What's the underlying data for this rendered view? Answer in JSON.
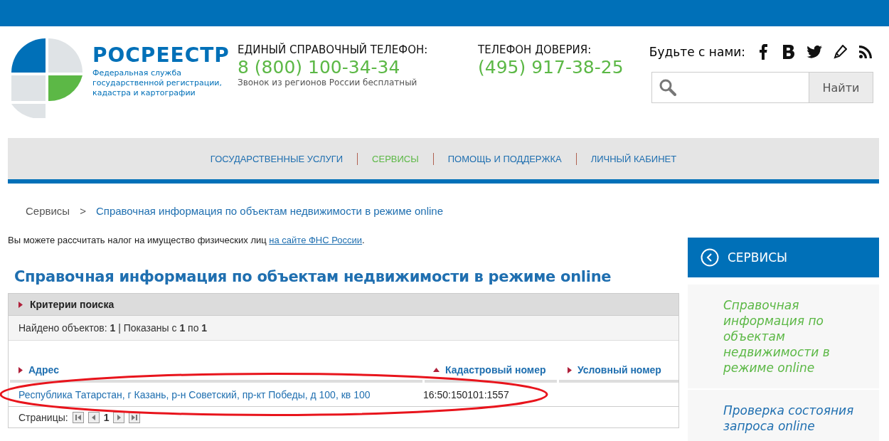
{
  "logo": {
    "name": "РОСРЕЕСТР",
    "tagline": "Федеральная служба государственной регистрации, кадастра и картографии"
  },
  "hotline": {
    "label": "ЕДИНЫЙ СПРАВОЧНЫЙ ТЕЛЕФОН:",
    "number": "8 (800) 100-34-34",
    "note": "Звонок из регионов России бесплатный"
  },
  "trustline": {
    "label": "ТЕЛЕФОН ДОВЕРИЯ:",
    "number": "(495) 917-38-25"
  },
  "social": {
    "label": "Будьте с нами:",
    "links": [
      {
        "kind": "facebook"
      },
      {
        "kind": "vk"
      },
      {
        "kind": "twitter"
      },
      {
        "kind": "blog"
      },
      {
        "kind": "rss"
      }
    ]
  },
  "search": {
    "button": "Найти"
  },
  "nav": [
    {
      "label": "ГОСУДАРСТВЕННЫЕ УСЛУГИ",
      "selected": false
    },
    {
      "label": "СЕРВИСЫ",
      "selected": true
    },
    {
      "label": "ПОМОЩЬ И ПОДДЕРЖКА",
      "selected": false
    },
    {
      "label": "ЛИЧНЫЙ КАБИНЕТ",
      "selected": false
    }
  ],
  "breadcrumb": [
    {
      "label": "Сервисы"
    },
    {
      "label": "Справочная информация по объектам недвижимости в режиме online"
    }
  ],
  "breadcrumb_separator": ">",
  "notice": {
    "text": "Вы можете рассчитать налог на имущество физических лиц ",
    "link": "на сайте ФНС России",
    "end": "."
  },
  "title": "Справочная информация по объектам недвижимости в режиме online",
  "criteria": {
    "label": "Критерии поиска",
    "expanded": false
  },
  "summary": "Найдено объектов: **1** | Показаны с **1** по **1**",
  "table": {
    "columns": [
      {
        "label": "Адрес",
        "sorted": false
      },
      {
        "label": "Кадастровый номер",
        "sorted": true
      },
      {
        "label": "Условный номер",
        "sorted": false
      }
    ],
    "rows": [
      {
        "address": "Республика Татарстан, г Казань, р-н Советский, пр-кт Победы, д 100, кв 100",
        "cadastral": "16:50:150101:1557",
        "highlighted": true
      }
    ]
  },
  "pager": {
    "label": "Страницы:",
    "page": "1"
  },
  "sidebar": {
    "title": "СЕРВИСЫ",
    "items": [
      {
        "label": "Справочная информация по объектам недвижимости в режиме online",
        "selected": true
      },
      {
        "label": "Проверка состояния запроса online",
        "selected": false
      }
    ]
  }
}
